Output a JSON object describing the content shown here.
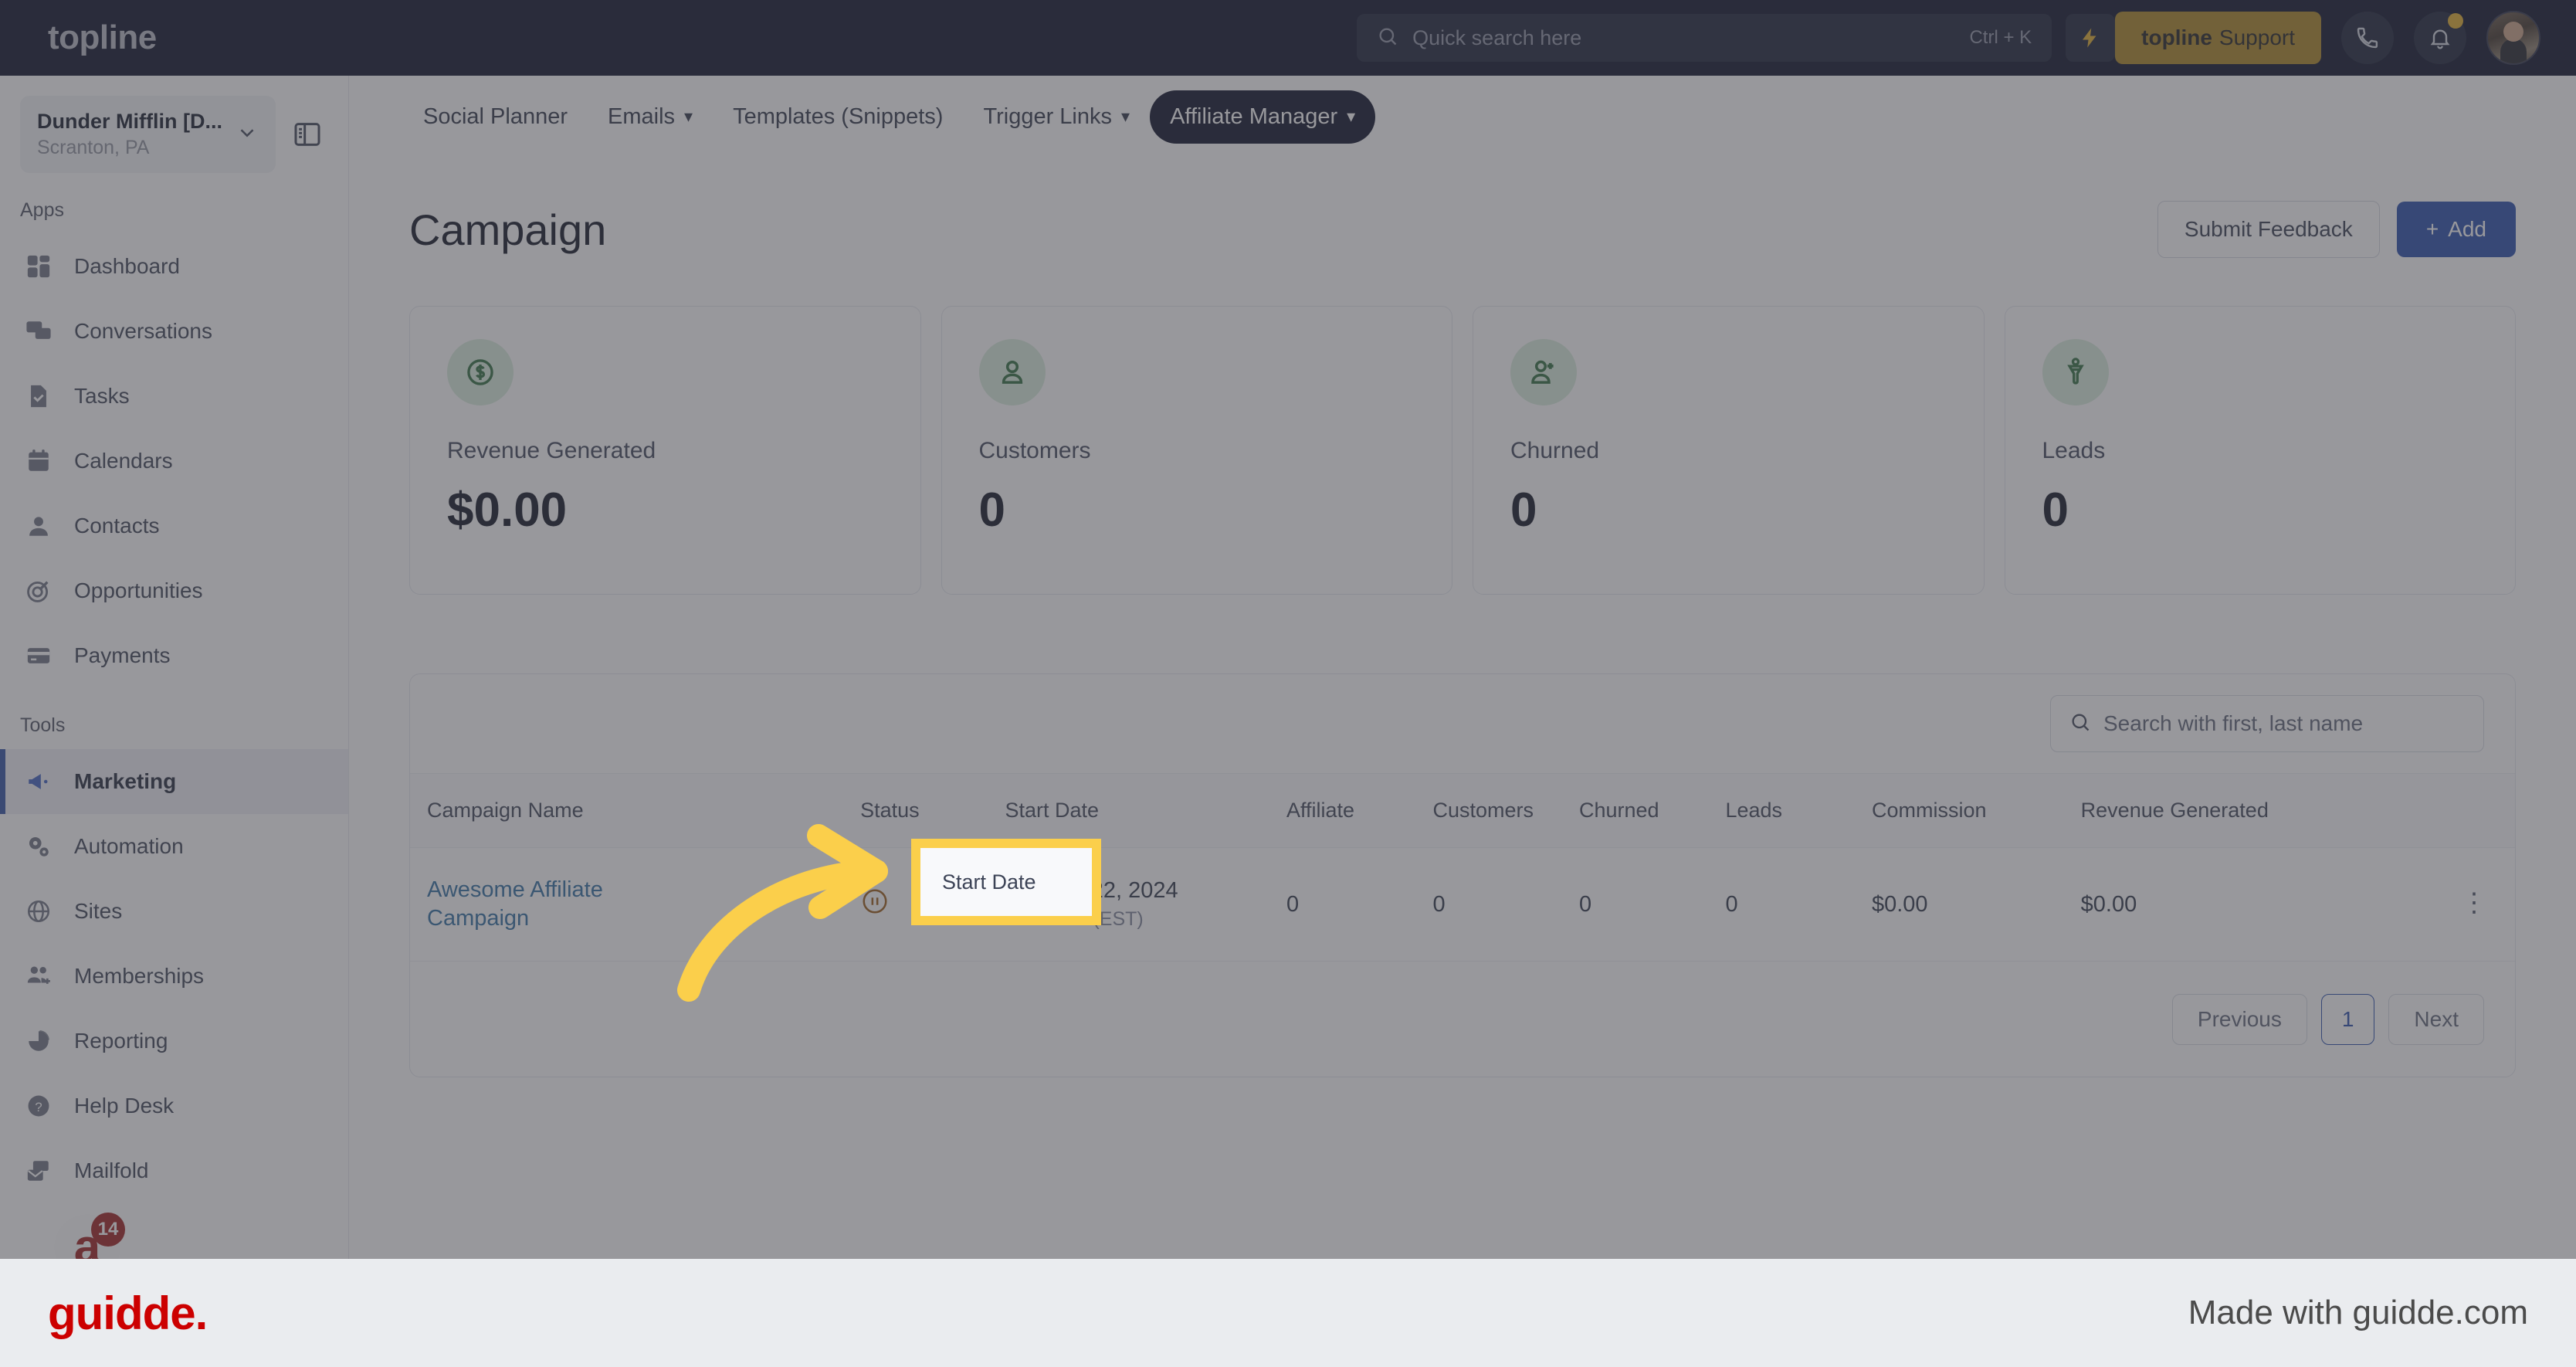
{
  "topbar": {
    "logo": "topline",
    "search": {
      "placeholder": "Quick search here",
      "shortcut": "Ctrl + K",
      "icon": "search-icon"
    },
    "bolt_icon": "lightning-bolt-icon",
    "support_button": {
      "brand": "topline",
      "label": " Support"
    },
    "phone_icon": "phone-icon",
    "bell_icon": "bell-icon",
    "avatar": "user-avatar"
  },
  "sidebar": {
    "location": {
      "name": "Dunder Mifflin [D...",
      "sub": "Scranton, PA",
      "caret": "chevron-down-icon"
    },
    "panel_toggle_icon": "panel-toggle-icon",
    "sections": [
      {
        "label": "Apps",
        "items": [
          {
            "label": "Dashboard",
            "icon": "dashboard-icon"
          },
          {
            "label": "Conversations",
            "icon": "chat-bubbles-icon"
          },
          {
            "label": "Tasks",
            "icon": "task-check-icon"
          },
          {
            "label": "Calendars",
            "icon": "calendar-icon"
          },
          {
            "label": "Contacts",
            "icon": "person-icon"
          },
          {
            "label": "Opportunities",
            "icon": "target-icon"
          },
          {
            "label": "Payments",
            "icon": "credit-card-icon"
          }
        ]
      },
      {
        "label": "Tools",
        "items": [
          {
            "label": "Marketing",
            "icon": "megaphone-icon",
            "active": true
          },
          {
            "label": "Automation",
            "icon": "gears-icon"
          },
          {
            "label": "Sites",
            "icon": "globe-icon"
          },
          {
            "label": "Memberships",
            "icon": "people-add-icon"
          },
          {
            "label": "Reporting",
            "icon": "pie-chart-icon"
          },
          {
            "label": "Help Desk",
            "icon": "question-circle-icon"
          },
          {
            "label": "Mailfold",
            "icon": "mail-stack-icon"
          }
        ]
      }
    ],
    "app_badge": {
      "glyph": "a",
      "count": "14"
    }
  },
  "subnav": {
    "tabs": [
      {
        "label": "Social Planner",
        "caret": false
      },
      {
        "label": "Emails",
        "caret": true
      },
      {
        "label": "Templates (Snippets)",
        "caret": false
      },
      {
        "label": "Trigger Links",
        "caret": true
      },
      {
        "label": "Affiliate Manager",
        "caret": true,
        "active": true
      }
    ]
  },
  "page": {
    "title": "Campaign",
    "submit_feedback_label": "Submit Feedback",
    "add_label": "Add",
    "add_icon": "plus-icon"
  },
  "stats": [
    {
      "label": "Revenue Generated",
      "value": "$0.00",
      "icon": "dollar-circle-icon"
    },
    {
      "label": "Customers",
      "value": "0",
      "icon": "person-icon"
    },
    {
      "label": "Churned",
      "value": "0",
      "icon": "person-plus-icon"
    },
    {
      "label": "Leads",
      "value": "0",
      "icon": "funnel-icon"
    }
  ],
  "table": {
    "search": {
      "placeholder": "Search with first, last name",
      "icon": "search-icon"
    },
    "columns": [
      "Campaign Name",
      "Status",
      "Start Date",
      "Affiliate",
      "Customers",
      "Churned",
      "Leads",
      "Commission",
      "Revenue Generated"
    ],
    "rows": [
      {
        "campaign_name": "Awesome Affiliate Campaign",
        "status_icon": "pause-circle-icon",
        "start_date": "January 22, 2024",
        "start_time": "03:36 PM (EST)",
        "affiliate": "0",
        "customers": "0",
        "churned": "0",
        "leads": "0",
        "commission": "$0.00",
        "revenue_generated": "$0.00",
        "row_menu_icon": "kebab-menu-icon"
      }
    ],
    "pagination": {
      "previous": "Previous",
      "current": "1",
      "next": "Next"
    }
  },
  "annotation": {
    "spotlight_label": "Start Date",
    "highlight_color": "#fbcf4b",
    "arrow_icon": "curved-arrow-icon"
  },
  "footer": {
    "logo": "guidde.",
    "made_with": "Made with guidde.com",
    "logo_color": "#cc0000"
  },
  "colors": {
    "topbar_bg": "#050b22",
    "accent_blue": "#2449a8",
    "support_gold": "#a8821f",
    "stat_icon_green": "#2c6b3c",
    "link_blue": "#2c6ba0"
  }
}
